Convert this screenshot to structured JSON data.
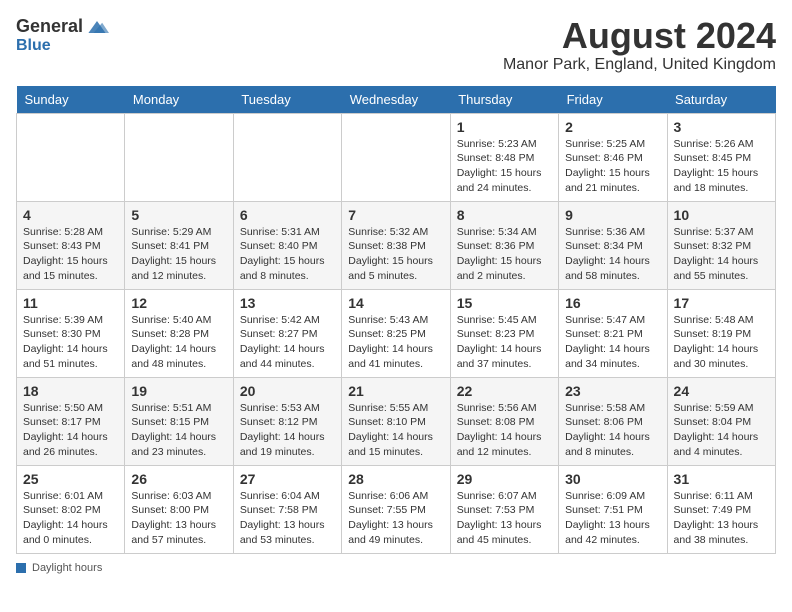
{
  "header": {
    "logo_general": "General",
    "logo_blue": "Blue",
    "month_title": "August 2024",
    "location": "Manor Park, England, United Kingdom"
  },
  "days_of_week": [
    "Sunday",
    "Monday",
    "Tuesday",
    "Wednesday",
    "Thursday",
    "Friday",
    "Saturday"
  ],
  "weeks": [
    [
      {
        "num": "",
        "info": ""
      },
      {
        "num": "",
        "info": ""
      },
      {
        "num": "",
        "info": ""
      },
      {
        "num": "",
        "info": ""
      },
      {
        "num": "1",
        "info": "Sunrise: 5:23 AM\nSunset: 8:48 PM\nDaylight: 15 hours\nand 24 minutes."
      },
      {
        "num": "2",
        "info": "Sunrise: 5:25 AM\nSunset: 8:46 PM\nDaylight: 15 hours\nand 21 minutes."
      },
      {
        "num": "3",
        "info": "Sunrise: 5:26 AM\nSunset: 8:45 PM\nDaylight: 15 hours\nand 18 minutes."
      }
    ],
    [
      {
        "num": "4",
        "info": "Sunrise: 5:28 AM\nSunset: 8:43 PM\nDaylight: 15 hours\nand 15 minutes."
      },
      {
        "num": "5",
        "info": "Sunrise: 5:29 AM\nSunset: 8:41 PM\nDaylight: 15 hours\nand 12 minutes."
      },
      {
        "num": "6",
        "info": "Sunrise: 5:31 AM\nSunset: 8:40 PM\nDaylight: 15 hours\nand 8 minutes."
      },
      {
        "num": "7",
        "info": "Sunrise: 5:32 AM\nSunset: 8:38 PM\nDaylight: 15 hours\nand 5 minutes."
      },
      {
        "num": "8",
        "info": "Sunrise: 5:34 AM\nSunset: 8:36 PM\nDaylight: 15 hours\nand 2 minutes."
      },
      {
        "num": "9",
        "info": "Sunrise: 5:36 AM\nSunset: 8:34 PM\nDaylight: 14 hours\nand 58 minutes."
      },
      {
        "num": "10",
        "info": "Sunrise: 5:37 AM\nSunset: 8:32 PM\nDaylight: 14 hours\nand 55 minutes."
      }
    ],
    [
      {
        "num": "11",
        "info": "Sunrise: 5:39 AM\nSunset: 8:30 PM\nDaylight: 14 hours\nand 51 minutes."
      },
      {
        "num": "12",
        "info": "Sunrise: 5:40 AM\nSunset: 8:28 PM\nDaylight: 14 hours\nand 48 minutes."
      },
      {
        "num": "13",
        "info": "Sunrise: 5:42 AM\nSunset: 8:27 PM\nDaylight: 14 hours\nand 44 minutes."
      },
      {
        "num": "14",
        "info": "Sunrise: 5:43 AM\nSunset: 8:25 PM\nDaylight: 14 hours\nand 41 minutes."
      },
      {
        "num": "15",
        "info": "Sunrise: 5:45 AM\nSunset: 8:23 PM\nDaylight: 14 hours\nand 37 minutes."
      },
      {
        "num": "16",
        "info": "Sunrise: 5:47 AM\nSunset: 8:21 PM\nDaylight: 14 hours\nand 34 minutes."
      },
      {
        "num": "17",
        "info": "Sunrise: 5:48 AM\nSunset: 8:19 PM\nDaylight: 14 hours\nand 30 minutes."
      }
    ],
    [
      {
        "num": "18",
        "info": "Sunrise: 5:50 AM\nSunset: 8:17 PM\nDaylight: 14 hours\nand 26 minutes."
      },
      {
        "num": "19",
        "info": "Sunrise: 5:51 AM\nSunset: 8:15 PM\nDaylight: 14 hours\nand 23 minutes."
      },
      {
        "num": "20",
        "info": "Sunrise: 5:53 AM\nSunset: 8:12 PM\nDaylight: 14 hours\nand 19 minutes."
      },
      {
        "num": "21",
        "info": "Sunrise: 5:55 AM\nSunset: 8:10 PM\nDaylight: 14 hours\nand 15 minutes."
      },
      {
        "num": "22",
        "info": "Sunrise: 5:56 AM\nSunset: 8:08 PM\nDaylight: 14 hours\nand 12 minutes."
      },
      {
        "num": "23",
        "info": "Sunrise: 5:58 AM\nSunset: 8:06 PM\nDaylight: 14 hours\nand 8 minutes."
      },
      {
        "num": "24",
        "info": "Sunrise: 5:59 AM\nSunset: 8:04 PM\nDaylight: 14 hours\nand 4 minutes."
      }
    ],
    [
      {
        "num": "25",
        "info": "Sunrise: 6:01 AM\nSunset: 8:02 PM\nDaylight: 14 hours\nand 0 minutes."
      },
      {
        "num": "26",
        "info": "Sunrise: 6:03 AM\nSunset: 8:00 PM\nDaylight: 13 hours\nand 57 minutes."
      },
      {
        "num": "27",
        "info": "Sunrise: 6:04 AM\nSunset: 7:58 PM\nDaylight: 13 hours\nand 53 minutes."
      },
      {
        "num": "28",
        "info": "Sunrise: 6:06 AM\nSunset: 7:55 PM\nDaylight: 13 hours\nand 49 minutes."
      },
      {
        "num": "29",
        "info": "Sunrise: 6:07 AM\nSunset: 7:53 PM\nDaylight: 13 hours\nand 45 minutes."
      },
      {
        "num": "30",
        "info": "Sunrise: 6:09 AM\nSunset: 7:51 PM\nDaylight: 13 hours\nand 42 minutes."
      },
      {
        "num": "31",
        "info": "Sunrise: 6:11 AM\nSunset: 7:49 PM\nDaylight: 13 hours\nand 38 minutes."
      }
    ]
  ],
  "footer": {
    "daylight_label": "Daylight hours"
  }
}
